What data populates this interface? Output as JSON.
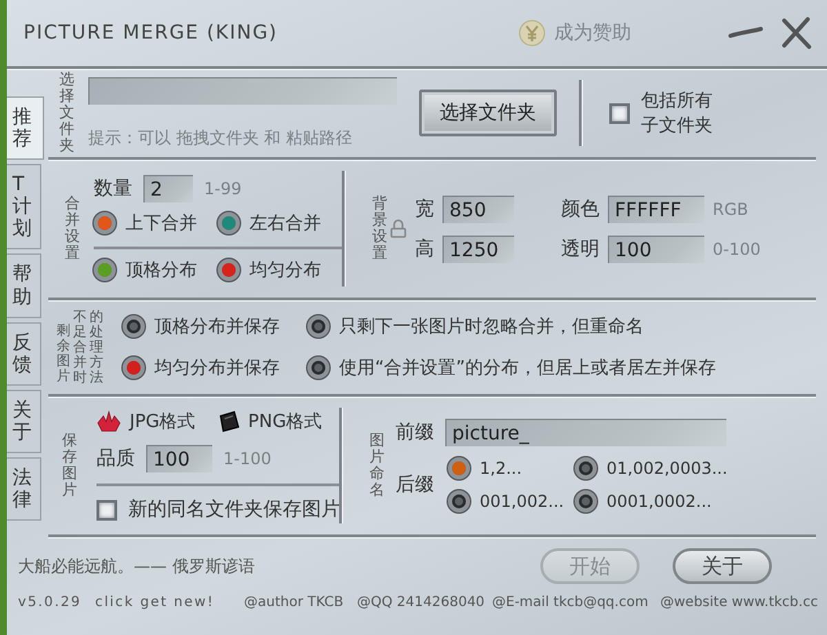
{
  "window": {
    "title": "PICTURE MERGE (KING)",
    "sponsor": "成为赞助"
  },
  "sidebar": {
    "tabs": [
      {
        "label": "推荐",
        "selected": true
      },
      {
        "label": "T计划",
        "selected": false
      },
      {
        "label": "帮助",
        "selected": false
      },
      {
        "label": "反馈",
        "selected": false
      },
      {
        "label": "关于",
        "selected": false
      },
      {
        "label": "法律",
        "selected": false
      }
    ]
  },
  "folder": {
    "label": "选择文件夹",
    "hint": "提示：可以 拖拽文件夹 和 粘贴路径",
    "button": "选择文件夹",
    "include_subfolders": {
      "label": "包括所有子文件夹",
      "checked": false
    }
  },
  "merge": {
    "label": "合并设置",
    "count": {
      "label": "数量",
      "value": "2",
      "range": "1-99"
    },
    "direction": [
      {
        "label": "上下合并",
        "color": "#e2561a"
      },
      {
        "label": "左右合并",
        "color": "#1f8a7c"
      }
    ],
    "distribution": [
      {
        "label": "顶格分布",
        "color": "#5a9e22"
      },
      {
        "label": "均匀分布",
        "color": "#d8231c"
      }
    ]
  },
  "background": {
    "label": "背景设置",
    "width": {
      "label": "宽",
      "value": "850"
    },
    "height": {
      "label": "高",
      "value": "1250"
    },
    "color": {
      "label": "颜色",
      "value": "FFFFFF",
      "unit": "RGB"
    },
    "opacity": {
      "label": "透明",
      "value": "100",
      "unit": "0-100"
    }
  },
  "remainder": {
    "label_columns": [
      "剩余图片",
      "不足合并时",
      "的处理方法"
    ],
    "options": [
      {
        "label": "顶格分布并保存",
        "selected": false
      },
      {
        "label": "只剩下一张图片时忽略合并，但重命名",
        "selected": false
      },
      {
        "label": "均匀分布并保存",
        "selected": true
      },
      {
        "label": "使用“合并设置”的分布，但居上或者居左并保存",
        "selected": false
      }
    ]
  },
  "save": {
    "label": "保存图片",
    "formats": [
      {
        "label": "JPG格式",
        "kind": "jpg"
      },
      {
        "label": "PNG格式",
        "kind": "png"
      }
    ],
    "quality": {
      "label": "品质",
      "value": "100",
      "range": "1-100"
    },
    "new_folder": {
      "label": "新的同名文件夹保存图片",
      "checked": false
    }
  },
  "naming": {
    "label": "图片命名",
    "prefix": {
      "label": "前缀",
      "value": "picture_"
    },
    "suffix": {
      "label": "后缀",
      "options": [
        {
          "label": "1,2...",
          "selected": true
        },
        {
          "label": "01,002,0003...",
          "selected": false
        },
        {
          "label": "001,002...",
          "selected": false
        },
        {
          "label": "0001,0002...",
          "selected": false
        }
      ]
    }
  },
  "quote": "大船必能远航。—— 俄罗斯谚语",
  "buttons": [
    {
      "label": "开始",
      "disabled": true
    },
    {
      "label": "关于",
      "disabled": false
    }
  ],
  "footer": [
    "v5.0.29",
    "click get new!",
    "@author TKCB",
    "@QQ 2414268040",
    "@E-mail tkcb@qq.com",
    "@website www.tkcb.cc"
  ]
}
